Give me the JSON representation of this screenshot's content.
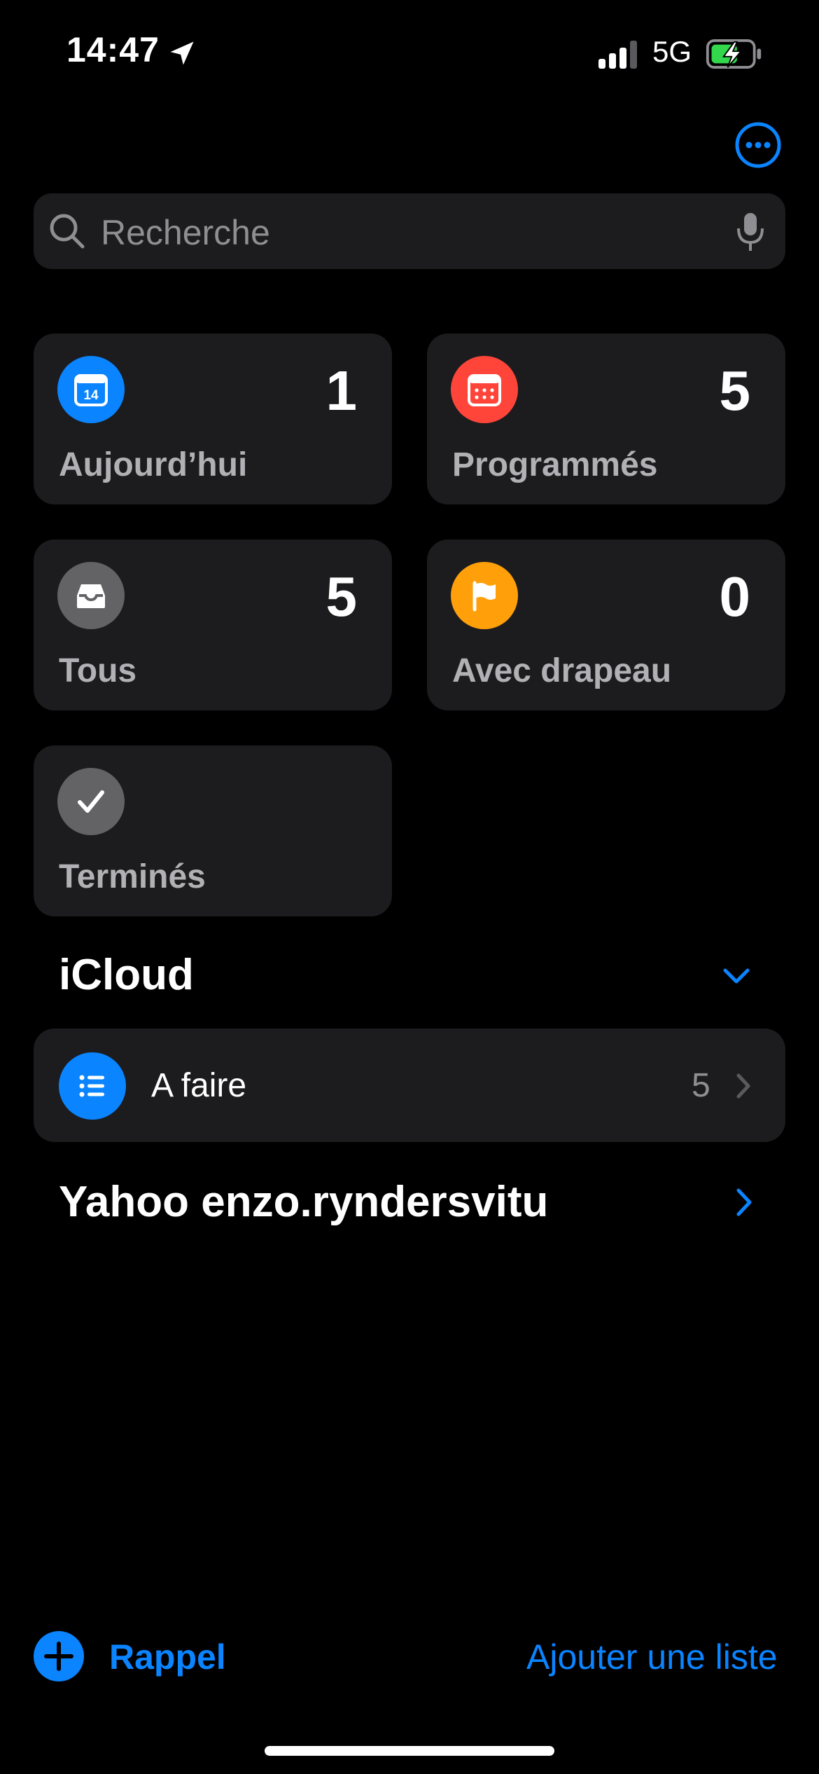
{
  "status_bar": {
    "time": "14:47",
    "network": "5G",
    "location_icon": "location-arrow-icon",
    "signal_icon": "cellular-signal-icon",
    "battery_icon": "battery-charging-icon"
  },
  "header": {
    "more_icon": "ellipsis-circle-icon"
  },
  "search": {
    "placeholder": "Recherche",
    "value": "",
    "icon": "search-icon",
    "mic_icon": "microphone-icon"
  },
  "smart_lists": [
    {
      "label": "Aujourd’hui",
      "count": "1",
      "icon": "calendar-today-icon",
      "icon_text": "14",
      "color": "#0a84ff"
    },
    {
      "label": "Programmés",
      "count": "5",
      "icon": "calendar-scheduled-icon",
      "color": "#ff453a"
    },
    {
      "label": "Tous",
      "count": "5",
      "icon": "tray-icon",
      "color": "#636366"
    },
    {
      "label": "Avec drapeau",
      "count": "0",
      "icon": "flag-icon",
      "color": "#ff9f0a"
    },
    {
      "label": "Terminés",
      "count": "",
      "icon": "checkmark-icon",
      "color": "#636366"
    }
  ],
  "icloud": {
    "title": "iCloud",
    "lists": [
      {
        "name": "A faire",
        "count": "5",
        "icon": "list-bullet-icon",
        "color": "#0a84ff"
      }
    ]
  },
  "yahoo": {
    "title": "Yahoo enzo.ryndersvitu"
  },
  "toolbar": {
    "add_reminder_label": "Rappel",
    "add_list_label": "Ajouter une liste"
  },
  "colors": {
    "accent": "#0a84ff",
    "background": "#000000",
    "card": "#1c1c1e",
    "secondary_text": "#8e8e93"
  }
}
